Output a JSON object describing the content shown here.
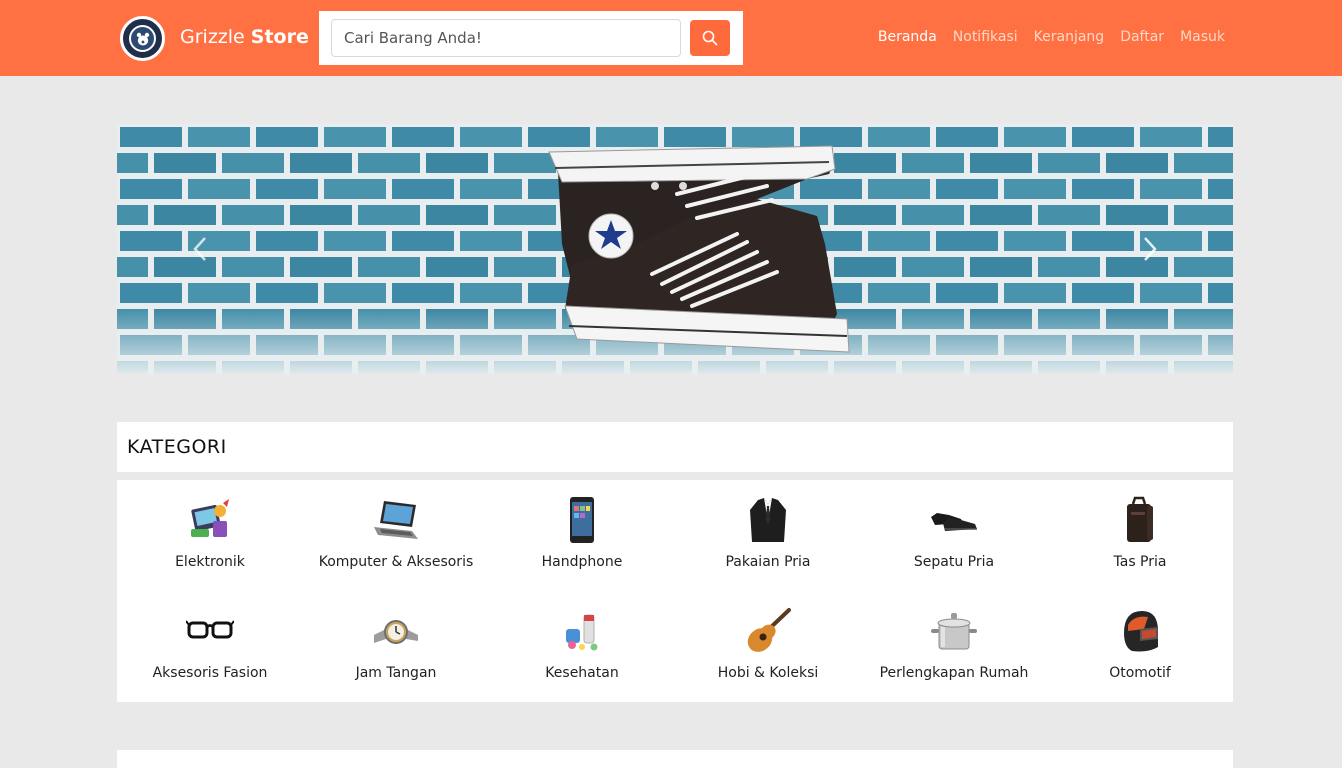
{
  "header": {
    "logo_text": "GRIZZLE SMART BANDUNG",
    "brand_light": "Grizzle",
    "brand_bold": "Store",
    "search": {
      "placeholder": "Cari Barang Anda!",
      "value": ""
    },
    "nav": [
      {
        "label": "Beranda",
        "active": true
      },
      {
        "label": "Notifikasi",
        "active": false
      },
      {
        "label": "Keranjang",
        "active": false
      },
      {
        "label": "Daftar",
        "active": false
      },
      {
        "label": "Masuk",
        "active": false
      }
    ],
    "accent_color": "#ff7142"
  },
  "banner": {
    "shoe_logo_text": "ALL STAR CONVERSE"
  },
  "kategori": {
    "title": "KATEGORI",
    "items": [
      {
        "label": "Elektronik",
        "icon": "electronics-icon"
      },
      {
        "label": "Komputer & Aksesoris",
        "icon": "laptop-icon"
      },
      {
        "label": "Handphone",
        "icon": "smartphone-icon"
      },
      {
        "label": "Pakaian Pria",
        "icon": "suit-icon"
      },
      {
        "label": "Sepatu Pria",
        "icon": "shoes-icon"
      },
      {
        "label": "Tas Pria",
        "icon": "bag-icon"
      },
      {
        "label": "Aksesoris Fasion",
        "icon": "glasses-icon"
      },
      {
        "label": "Jam Tangan",
        "icon": "watch-icon"
      },
      {
        "label": "Kesehatan",
        "icon": "health-icon"
      },
      {
        "label": "Hobi & Koleksi",
        "icon": "guitar-icon"
      },
      {
        "label": "Perlengkapan Rumah",
        "icon": "pot-icon"
      },
      {
        "label": "Otomotif",
        "icon": "helmet-icon"
      }
    ]
  }
}
